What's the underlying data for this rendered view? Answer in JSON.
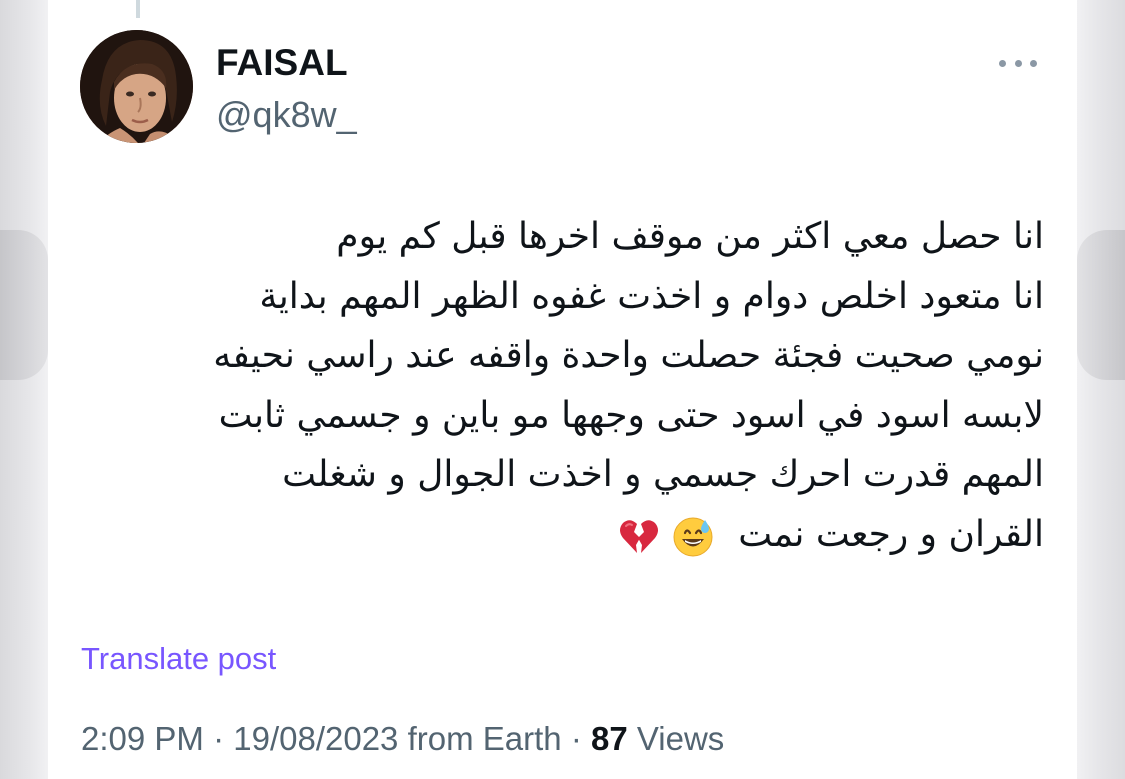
{
  "author": {
    "display_name": "FAISAL",
    "handle": "@qk8w_"
  },
  "tweet": {
    "lines": [
      "انا حصل معي اكثر من موقف اخرها قبل كم يوم",
      "انا متعود اخلص دوام و اخذت غفوه الظهر المهم بداية",
      "نومي صحيت فجئة حصلت واحدة واقفه عند راسي نحيفه",
      "لابسه اسود في اسود حتى وجهها مو باين و جسمي ثابت",
      "المهم قدرت احرك جسمي و اخذت الجوال و شغلت",
      "القران و رجعت نمت"
    ],
    "emojis": [
      "grinning-sweat-emoji",
      "broken-heart-emoji"
    ]
  },
  "translate_label": "Translate post",
  "meta": {
    "time": "2:09 PM",
    "separator": "·",
    "date": "19/08/2023",
    "source": "from Earth",
    "views_count": "87",
    "views_label": "Views"
  },
  "colors": {
    "translate_link": "#7856ff",
    "secondary_text": "#536471",
    "primary_text": "#0f1419"
  }
}
